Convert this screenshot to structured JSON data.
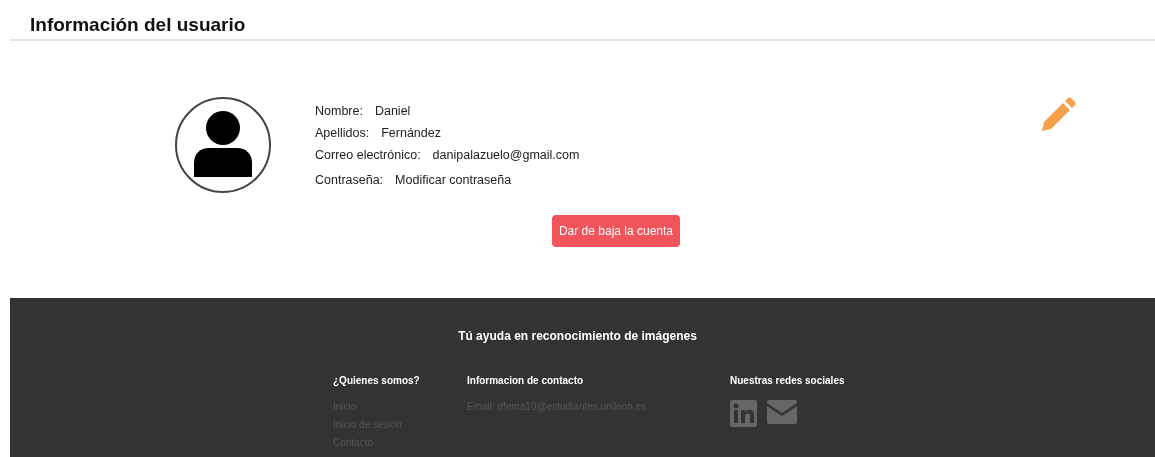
{
  "page_title": "Información del usuario",
  "fields": [
    {
      "label": "Nombre:",
      "value": "Daniel"
    },
    {
      "label": "Apellidos:",
      "value": "Fernández"
    },
    {
      "label": "Correo electrónico:",
      "value": "danipalazuelo@gmail.com"
    },
    {
      "label": "Contraseña:",
      "value": "Modificar contraseña",
      "kind": "link"
    }
  ],
  "delete_button": "Dar de baja la cuenta",
  "footer": {
    "tagline": "Tú ayuda en reconocimiento de imágenes",
    "columns": [
      {
        "heading": "¿Quienes somos?",
        "links": [
          "Inicio",
          "Inicio de sesión",
          "Contacto"
        ]
      },
      {
        "heading": "Informacion de contacto",
        "links": [
          "Email: dfema10@estudiantes.unileon.es"
        ]
      },
      {
        "heading": "Nuestras redes sociales",
        "kind": "social"
      }
    ]
  }
}
